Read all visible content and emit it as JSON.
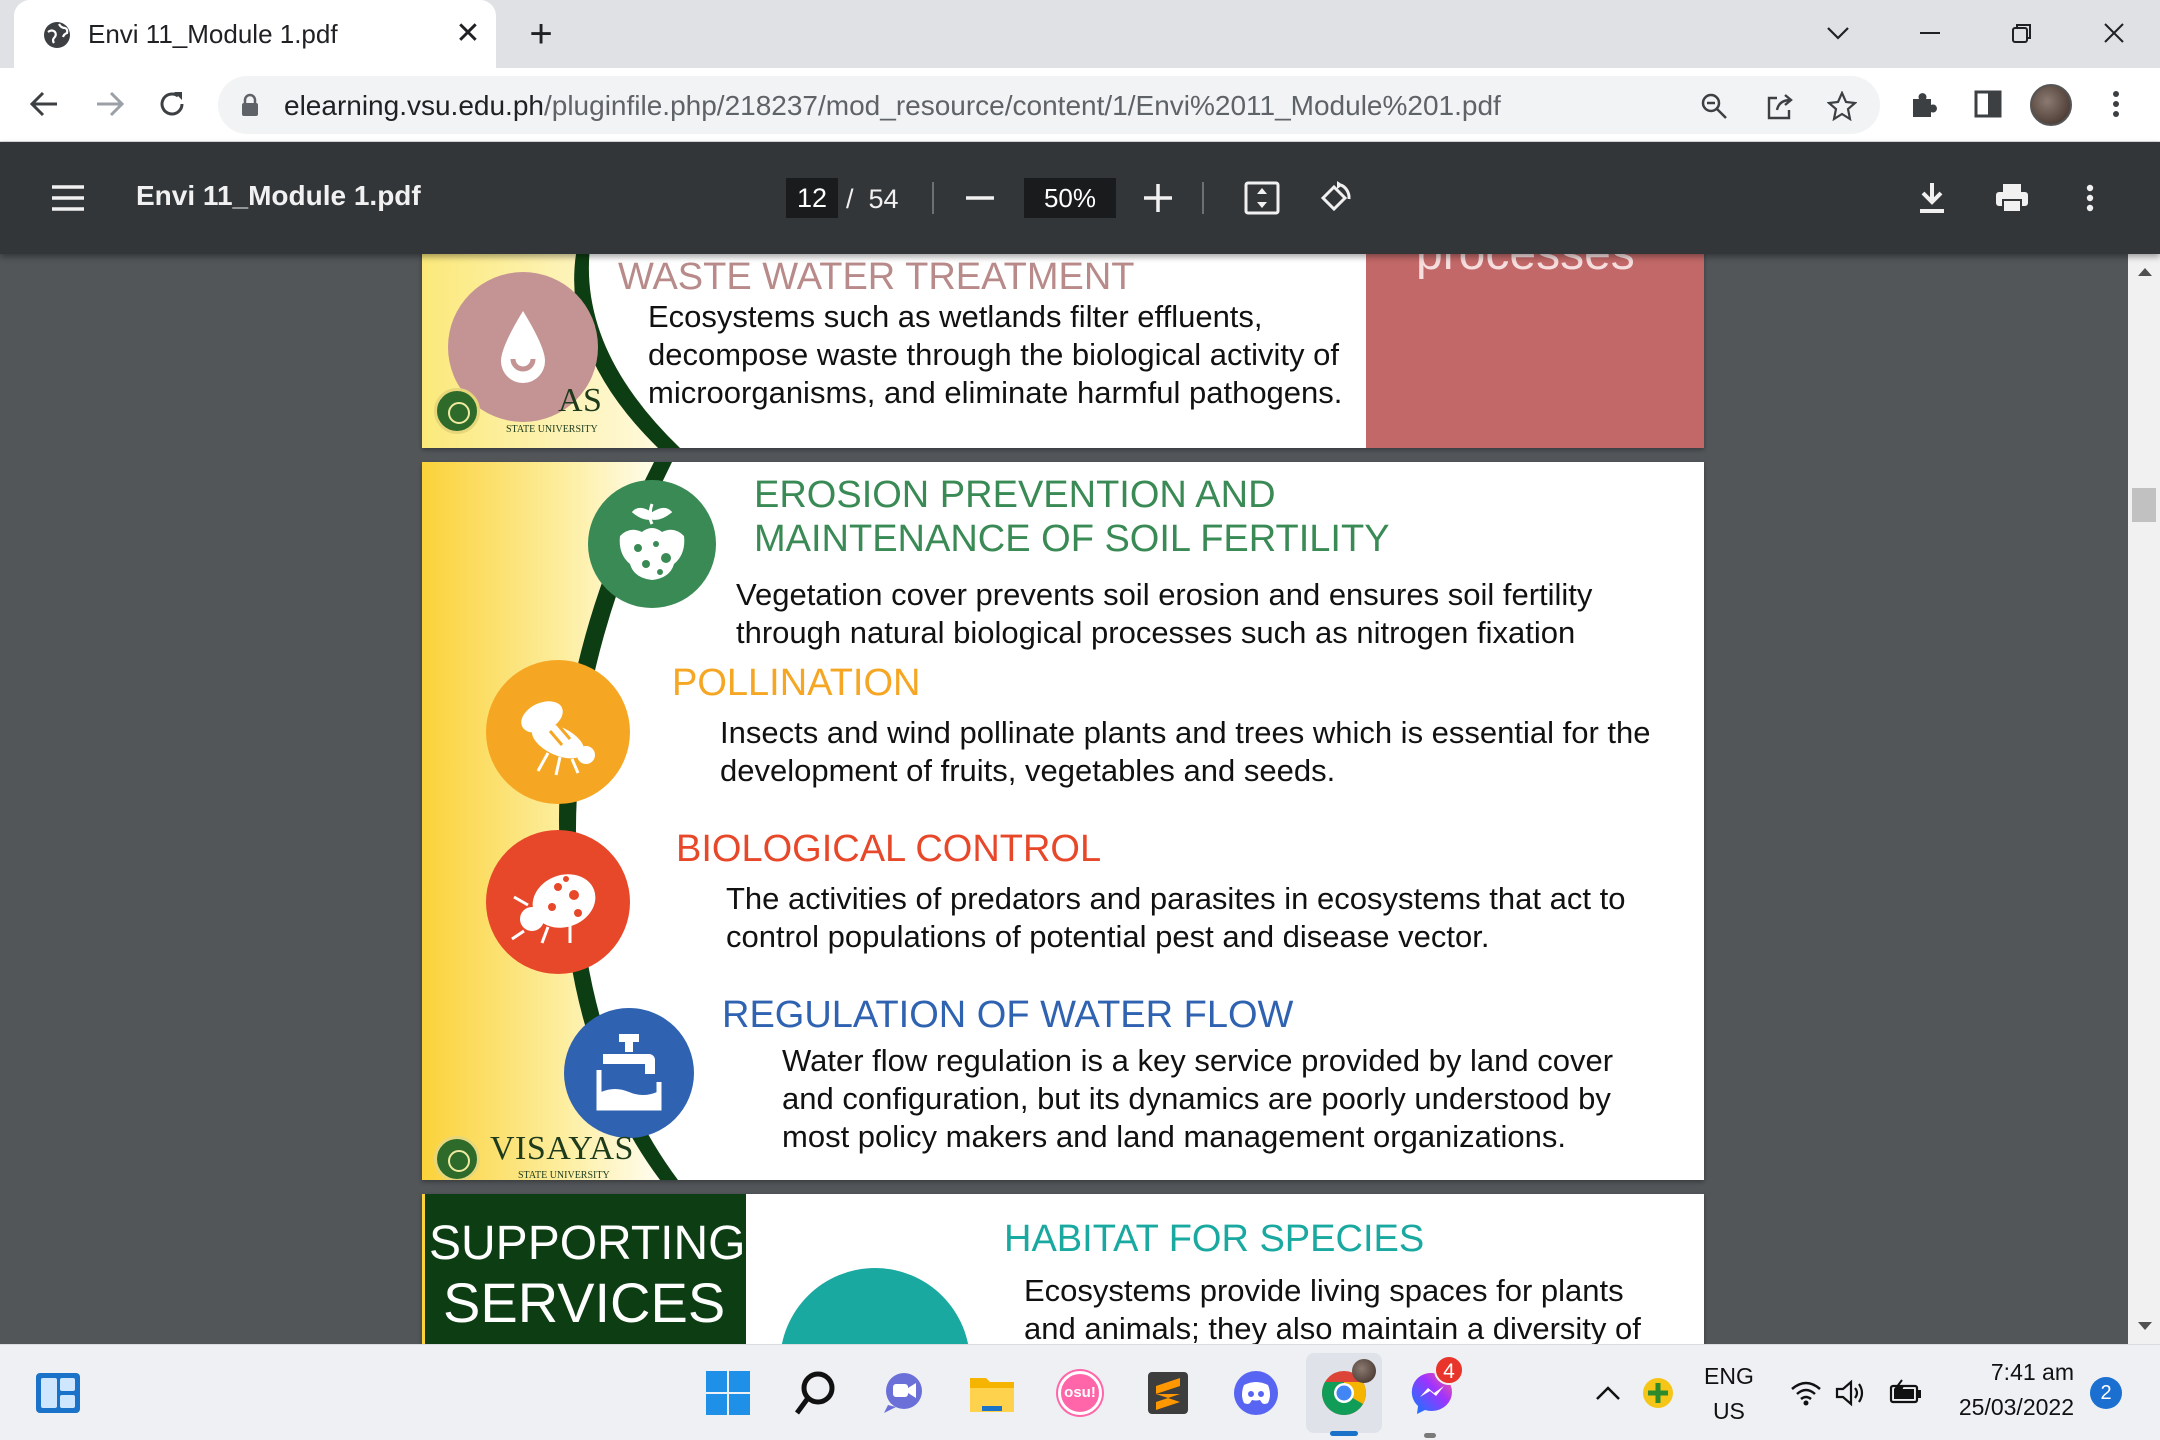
{
  "browser": {
    "tab_title": "Envi 11_Module 1.pdf",
    "url_host": "elearning.vsu.edu.ph",
    "url_path": "/pluginfile.php/218237/mod_resource/content/1/Envi%2011_Module%201.pdf",
    "icons": [
      "globe-icon",
      "close-icon",
      "plus-icon",
      "chevron-down-icon",
      "minimize-icon",
      "restore-icon",
      "close-window-icon",
      "back-icon",
      "forward-icon",
      "reload-icon",
      "lock-icon",
      "zoom-icon",
      "share-icon",
      "star-icon",
      "extensions-icon",
      "side-panel-icon",
      "avatar",
      "more-icon"
    ]
  },
  "pdf_toolbar": {
    "file_title": "Envi 11_Module 1.pdf",
    "current_page": "12",
    "page_separator": "/",
    "total_pages": "54",
    "zoom": "50%"
  },
  "slides": {
    "top_right_fragment": "processes",
    "waste": {
      "heading": "WASTE WATER TREATMENT",
      "lines": [
        "Ecosystems such as wetlands filter effluents,",
        "decompose waste through the biological activity of",
        "microorganisms, and eliminate harmful pathogens."
      ]
    },
    "logo_partial": "AS",
    "logo_name": "VISAYAS",
    "logo_sub": "STATE UNIVERSITY",
    "erosion": {
      "heading_1": "EROSION PREVENTION AND",
      "heading_2": "MAINTENANCE OF SOIL FERTILITY",
      "lines": [
        "Vegetation cover prevents soil erosion and ensures soil fertility",
        "through natural biological processes such as nitrogen fixation"
      ]
    },
    "pollination": {
      "heading": "POLLINATION",
      "lines": [
        "Insects and wind pollinate plants and trees which is essential for the",
        "development of fruits, vegetables and seeds."
      ]
    },
    "bio_control": {
      "heading": "BIOLOGICAL CONTROL",
      "lines": [
        "The activities of predators and parasites in ecosystems that act to",
        "control populations of potential pest and disease vector."
      ]
    },
    "water_flow": {
      "heading": "REGULATION OF WATER FLOW",
      "lines": [
        "Water flow regulation is a key service provided by land cover",
        "and configuration, but its dynamics are poorly understood by",
        "most policy makers and land management organizations."
      ]
    },
    "supporting": {
      "label_1": "SUPPORTING",
      "label_2": "SERVICES",
      "heading": "HABITAT FOR SPECIES",
      "lines": [
        "Ecosystems provide living spaces for plants",
        "and animals; they also maintain a diversity of"
      ]
    },
    "colors": {
      "waste": "#b88a8a",
      "erosion": "#3a8a55",
      "pollination": "#f5a623",
      "bio_control": "#e8482a",
      "water_flow": "#2f62b0",
      "habitat": "#1aa9a0",
      "dark_green": "#0d3d12",
      "rose_panel": "#c26868"
    }
  },
  "taskbar": {
    "osu_label": "osu!",
    "messenger_badge": "4",
    "lang_1": "ENG",
    "lang_2": "US",
    "time": "7:41 am",
    "date": "25/03/2022",
    "notification_count": "2"
  }
}
